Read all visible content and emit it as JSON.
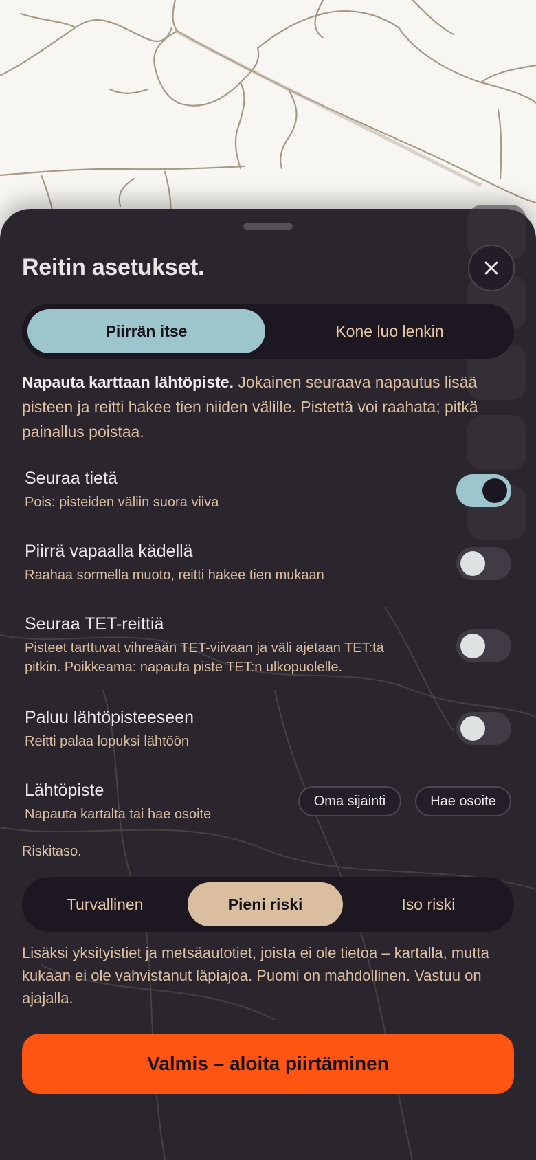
{
  "sheet": {
    "title": "Reitin asetukset.",
    "close_icon": "close-icon"
  },
  "mode_tabs": {
    "options": [
      "Piirrän itse",
      "Kone luo lenkin"
    ],
    "selected": "Piirrän itse"
  },
  "help": {
    "bold": "Napauta karttaan lähtöpiste.",
    "text": " Jokainen seuraava napautus lisää pisteen ja reitti hakee tien niiden välille. Pistettä voi raahata; pitkä painallus poistaa."
  },
  "options": [
    {
      "label": "Seuraa tietä",
      "sub": "Pois: pisteiden väliin suora viiva",
      "on": true
    },
    {
      "label": "Piirrä vapaalla kädellä",
      "sub": "Raahaa sormella muoto, reitti hakee tien mukaan",
      "on": false
    },
    {
      "label": "Seuraa TET-reittiä",
      "sub": "Pisteet tarttuvat vihreään TET-viivaan ja väli ajetaan TET:tä pitkin. Poikkeama: napauta piste TET:n ulkopuolelle.",
      "on": false
    },
    {
      "label": "Paluu lähtöpisteeseen",
      "sub": "Reitti palaa lopuksi lähtöön",
      "on": false
    }
  ],
  "start_point": {
    "label": "Lähtöpiste",
    "sub": "Napauta kartalta tai hae osoite",
    "own_location": "Oma sijainti",
    "search_address": "Hae osoite"
  },
  "risk": {
    "label": "Riskitaso.",
    "options": [
      "Turvallinen",
      "Pieni riski",
      "Iso riski"
    ],
    "selected": "Pieni riski",
    "description": "Lisäksi yksityistiet ja metsäautotiet, joista ei ole tietoa – kartalla, mutta kukaan ei ole vahvistanut läpiajoa. Puomi on mahdollinen. Vastuu on ajajalla."
  },
  "done_button": "Valmis – aloita piirtäminen",
  "colors": {
    "accent_teal": "#9cc6cc",
    "accent_sand": "#d9bf9f",
    "primary_orange": "#ff5512",
    "sheet_bg": "#28232b"
  }
}
